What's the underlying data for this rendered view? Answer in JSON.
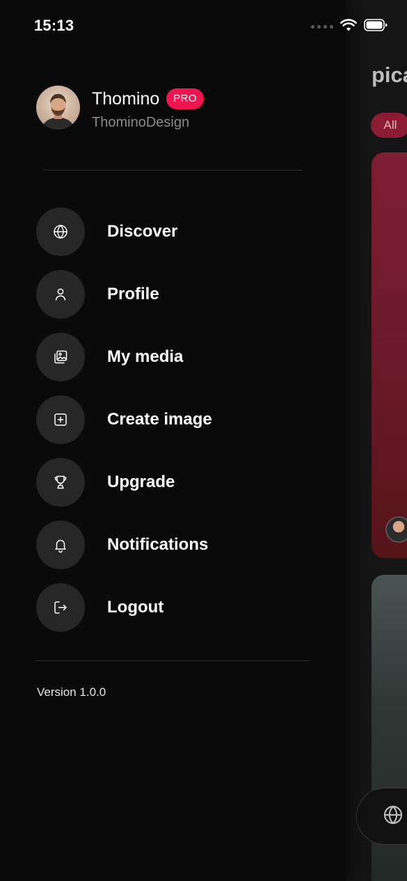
{
  "status_bar": {
    "time": "15:13"
  },
  "background_app": {
    "title": "pica",
    "filter_chip": "All",
    "accent_color": "#8c1b34"
  },
  "profile": {
    "name": "Thomino",
    "badge": "PRO",
    "handle": "ThominoDesign",
    "badge_color": "#f0154f"
  },
  "menu": {
    "items": [
      {
        "label": "Discover",
        "icon": "globe-icon"
      },
      {
        "label": "Profile",
        "icon": "user-icon"
      },
      {
        "label": "My media",
        "icon": "media-gallery-icon"
      },
      {
        "label": "Create image",
        "icon": "add-square-icon"
      },
      {
        "label": "Upgrade",
        "icon": "trophy-icon"
      },
      {
        "label": "Notifications",
        "icon": "bell-icon"
      },
      {
        "label": "Logout",
        "icon": "logout-icon"
      }
    ]
  },
  "footer": {
    "version": "Version 1.0.0"
  }
}
